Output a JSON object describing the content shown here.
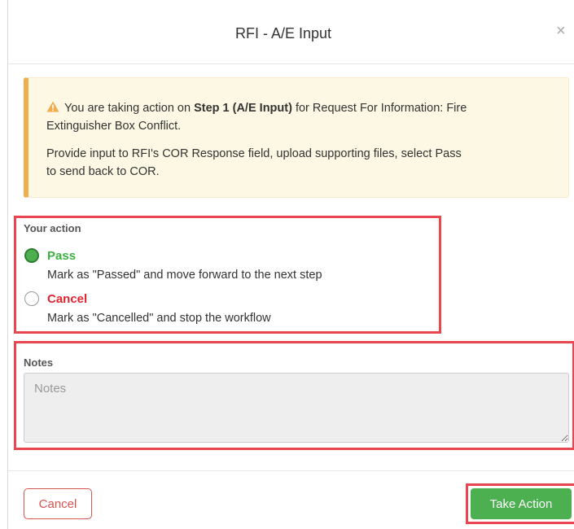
{
  "modal": {
    "title": "RFI - A/E Input",
    "close_label": "×"
  },
  "alert": {
    "icon": "warning-triangle-icon",
    "text_before": "You are taking action on ",
    "step_bold": "Step 1 (A/E Input)",
    "text_after": " for Request For Information: Fire",
    "line2": "Extinguisher Box Conflict.",
    "line3": "Provide input to RFI's COR Response field, upload supporting files, select Pass",
    "line4": "to send back to COR."
  },
  "action": {
    "label": "Your action",
    "selected": "Pass",
    "options": [
      {
        "title": "Pass",
        "description": "Mark as \"Passed\" and move forward to the next step",
        "color": "#3cb043"
      },
      {
        "title": "Cancel",
        "description": "Mark as \"Cancelled\" and stop the workflow",
        "color": "#e0242f"
      }
    ]
  },
  "notes": {
    "label": "Notes",
    "placeholder": "Notes",
    "value": ""
  },
  "footer": {
    "cancel_label": "Cancel",
    "take_action_label": "Take Action"
  },
  "colors": {
    "highlight": "#e8474f",
    "success": "#4caf50",
    "danger": "#d9534f",
    "warning_bg": "#fcf8e3",
    "warning_border": "#f0ad4e"
  }
}
